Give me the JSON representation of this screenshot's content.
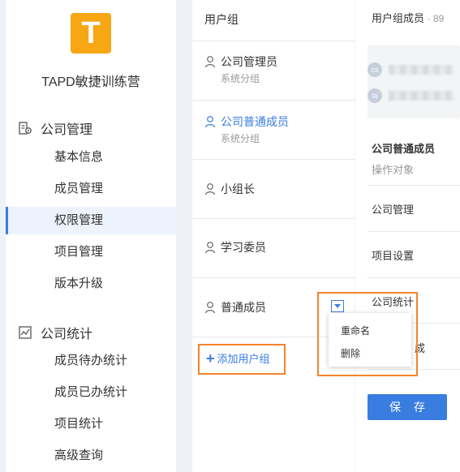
{
  "sidebar": {
    "logo_letter": "T",
    "brand": "TAPD敏捷训练营",
    "sections": [
      {
        "label": "公司管理",
        "icon": "company-management-icon",
        "items": [
          "基本信息",
          "成员管理",
          "权限管理",
          "项目管理",
          "版本升级"
        ]
      },
      {
        "label": "公司统计",
        "icon": "statistics-chart-icon",
        "items": [
          "成员待办统计",
          "成员已办统计",
          "项目统计",
          "高级查询"
        ]
      }
    ],
    "active_item": "权限管理"
  },
  "groups_panel": {
    "header": "用户组",
    "groups": [
      {
        "name": "公司管理员",
        "sub": "系统分组"
      },
      {
        "name": "公司普通成员",
        "sub": "系统分组"
      },
      {
        "name": "小组长",
        "sub": ""
      },
      {
        "name": "学习委员",
        "sub": ""
      },
      {
        "name": "普通成员",
        "sub": ""
      }
    ],
    "selected_group": "公司普通成员",
    "add_label": "添加用户组"
  },
  "context_menu": {
    "items": [
      "重命名",
      "删除"
    ]
  },
  "right_panel": {
    "members_title": "用户组成员",
    "members_count": "· 89",
    "member_avatars": [
      "cs",
      "la"
    ],
    "group_title": "公司普通成员",
    "operation_label": "操作对象",
    "permission_rows": [
      "公司管理",
      "项目设置",
      "公司统计",
      "成"
    ],
    "save_label": "保 存"
  },
  "colors": {
    "accent": "#3a7de0",
    "logo": "#f7a614",
    "highlight": "#f5832b"
  }
}
